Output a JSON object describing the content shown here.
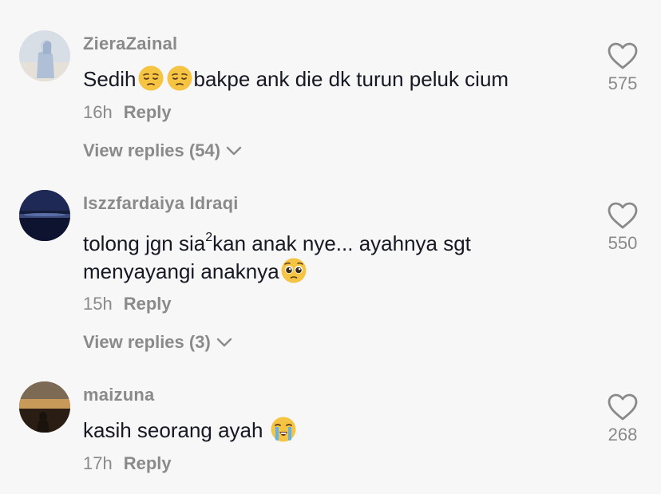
{
  "comments": [
    {
      "username": "ZieraZainal",
      "text_before": "Sedih",
      "emojis_1": [
        "pensive-face",
        "pensive-face"
      ],
      "text_after": "bakpe ank die dk turun peluk cium",
      "time": "16h",
      "reply_label": "Reply",
      "view_replies": "View replies (54)",
      "likes": "575"
    },
    {
      "username": "Iszzfardaiya Idraqi",
      "line1_a": "tolong jgn sia",
      "line1_sup": "2",
      "line1_b": "kan anak nye... ayahnya sgt",
      "line2": "menyayangi anaknya",
      "emoji": "pleading-face",
      "time": "15h",
      "reply_label": "Reply",
      "view_replies": "View replies (3)",
      "likes": "550"
    },
    {
      "username": "maizuna",
      "text": "kasih seorang ayah ",
      "emoji": "loudly-crying-face",
      "time": "17h",
      "reply_label": "Reply",
      "likes": "268"
    }
  ],
  "colors": {
    "background": "#f7f7f7",
    "text": "#161823",
    "muted": "#8a8a8a",
    "emoji_yellow": "#f6c443"
  },
  "icons": [
    "heart-icon",
    "chevron-down-icon"
  ]
}
